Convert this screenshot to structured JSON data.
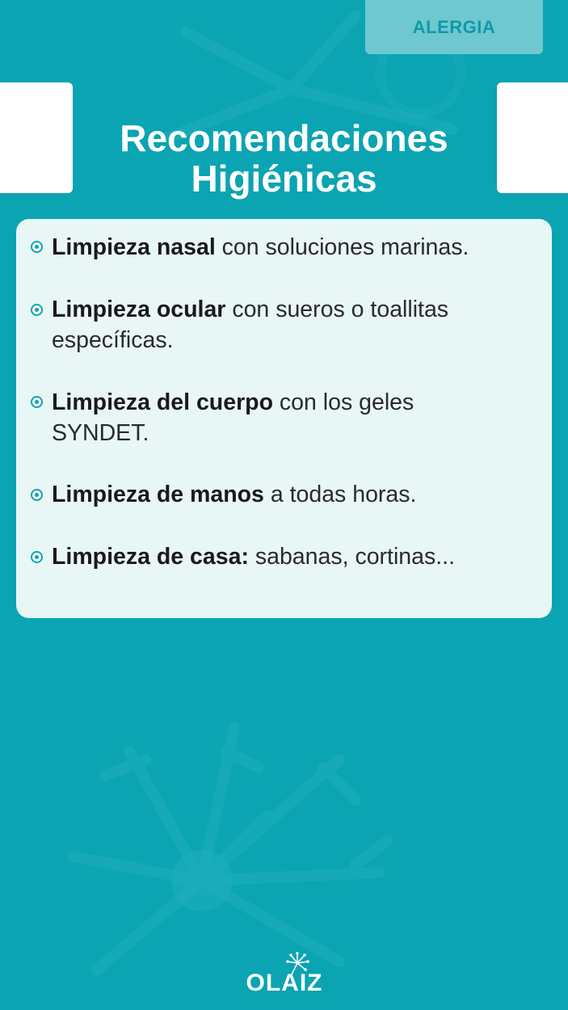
{
  "tag": {
    "label": "ALERGIA"
  },
  "title": {
    "line1": "Recomendaciones",
    "line2": "Higiénicas"
  },
  "items": [
    {
      "bold": "Limpieza nasal",
      "rest": " con soluciones marinas."
    },
    {
      "bold": "Limpieza ocular",
      "rest": " con sueros o toallitas específicas."
    },
    {
      "bold": "Limpieza del cuerpo",
      "rest": " con los geles SYNDET."
    },
    {
      "bold": "Limpieza de manos",
      "rest": " a todas horas."
    },
    {
      "bold": "Limpieza de casa:",
      "rest": " sabanas, cortinas..."
    }
  ],
  "logo": {
    "text": "OLAIZ"
  },
  "colors": {
    "background": "#0ba4b2",
    "card": "#e8f6f6",
    "tag": "#6fc8d0",
    "accent": "#0ba4b2"
  },
  "icons": {
    "bullet": "circle-bullet-icon",
    "background": "dandelion-decoration",
    "logo": "dandelion-logo-icon"
  }
}
